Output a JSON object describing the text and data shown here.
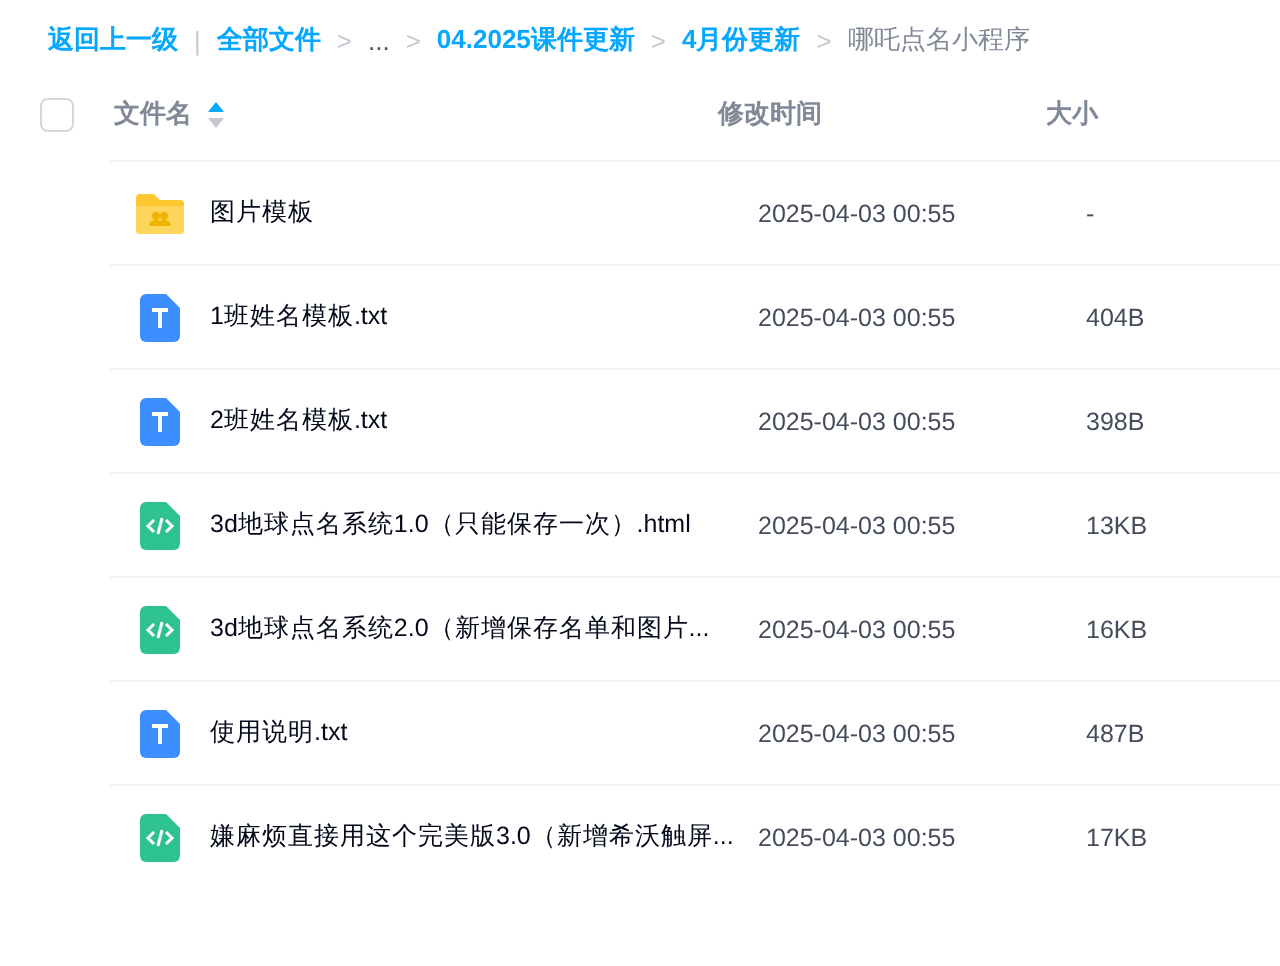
{
  "breadcrumb": [
    {
      "kind": "link",
      "text": "返回上一级"
    },
    {
      "kind": "bar",
      "text": "|"
    },
    {
      "kind": "link",
      "text": "全部文件"
    },
    {
      "kind": "arrow",
      "text": ">"
    },
    {
      "kind": "ellipsis",
      "text": "..."
    },
    {
      "kind": "arrow",
      "text": ">"
    },
    {
      "kind": "link",
      "text": "04.2025课件更新"
    },
    {
      "kind": "arrow",
      "text": ">"
    },
    {
      "kind": "link",
      "text": "4月份更新"
    },
    {
      "kind": "arrow",
      "text": ">"
    },
    {
      "kind": "current",
      "text": "哪吒点名小程序"
    }
  ],
  "table": {
    "select_all": {
      "checked": false
    },
    "columns": [
      {
        "label": "文件名",
        "sorted_ascending": true
      },
      {
        "label": "修改时间"
      },
      {
        "label": "大小"
      }
    ],
    "rows": [
      {
        "kind": "folder",
        "name": "图片模板",
        "modified": "2025-04-03 00:55",
        "size": "-"
      },
      {
        "kind": "txt",
        "name": "1班姓名模板.txt",
        "modified": "2025-04-03 00:55",
        "size": "404B"
      },
      {
        "kind": "txt",
        "name": "2班姓名模板.txt",
        "modified": "2025-04-03 00:55",
        "size": "398B"
      },
      {
        "kind": "html",
        "name": "3d地球点名系统1.0（只能保存一次）.html",
        "modified": "2025-04-03 00:55",
        "size": "13KB"
      },
      {
        "kind": "html",
        "name": "3d地球点名系统2.0（新增保存名单和图片...",
        "modified": "2025-04-03 00:55",
        "size": "16KB"
      },
      {
        "kind": "txt",
        "name": "使用说明.txt",
        "modified": "2025-04-03 00:55",
        "size": "487B"
      },
      {
        "kind": "html",
        "name": "嫌麻烦直接用这个完美版3.0（新增希沃触屏...",
        "modified": "2025-04-03 00:55",
        "size": "17KB"
      }
    ]
  }
}
